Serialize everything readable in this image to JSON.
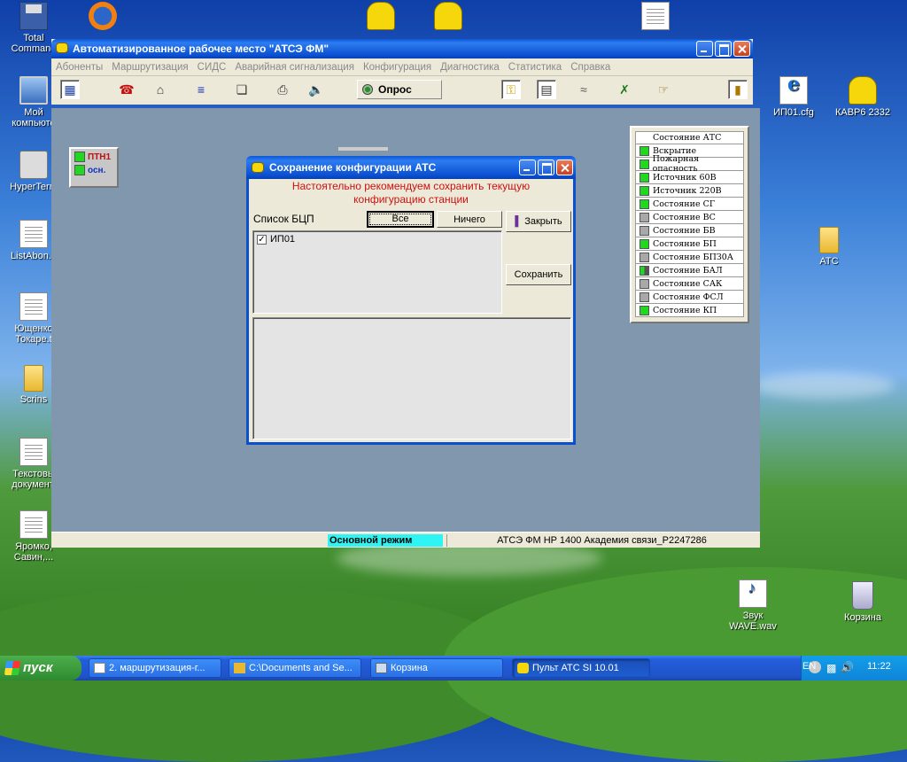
{
  "desktop": {
    "icons": [
      {
        "label": "Total Command"
      },
      {
        "label": "Мой компьюте"
      },
      {
        "label": "HyperTerm"
      },
      {
        "label": "ListAbon.n"
      },
      {
        "label": "Ющенко Токаре.t"
      },
      {
        "label": "Scrins"
      },
      {
        "label": "Текстовы документ."
      },
      {
        "label": "Яромко, Савин,..."
      },
      {
        "label": "ИП01.cfg"
      },
      {
        "label": "КАВР6 2332"
      },
      {
        "label": "АТС"
      },
      {
        "label": "Звук WAVE.wav"
      },
      {
        "label": "Корзина"
      }
    ]
  },
  "app": {
    "title": "Автоматизированное рабочее место \"АТСЭ ФМ\"",
    "menu": [
      "Абоненты",
      "Маршрутизация",
      "СИДС",
      "Аварийная сигнализация",
      "Конфигурация",
      "Диагностика",
      "Статистика",
      "Справка"
    ],
    "poll_label": "Опрос",
    "status": {
      "mode": "Основной режим",
      "info": "АТСЭ ФМ HP 1400 Академия связи_P2247286"
    }
  },
  "ptn": {
    "row1": "ПТН1",
    "row2": "осн."
  },
  "states": [
    {
      "label": "Состояние АТС",
      "led": "none"
    },
    {
      "label": "Вскрытие",
      "led": "green"
    },
    {
      "label": "Пожарная опасность",
      "led": "green"
    },
    {
      "label": "Источник 60В",
      "led": "green"
    },
    {
      "label": "Источник 220В",
      "led": "green"
    },
    {
      "label": "Состояние СГ",
      "led": "green"
    },
    {
      "label": "Состояние ВС",
      "led": "gray"
    },
    {
      "label": "Состояние БВ",
      "led": "gray"
    },
    {
      "label": "Состояние БП",
      "led": "green"
    },
    {
      "label": "Состояние БПЗ0А",
      "led": "gray"
    },
    {
      "label": "Состояние БАЛ",
      "led": "split"
    },
    {
      "label": "Состояние САК",
      "led": "gray"
    },
    {
      "label": "Состояние ФСЛ",
      "led": "gray"
    },
    {
      "label": "Состояние КП",
      "led": "green"
    }
  ],
  "dialog": {
    "title": "Сохранение конфигурации АТС",
    "warning_line1": "Настоятельно рекомендуем сохранить текущую",
    "warning_line2": "конфигурацию станции",
    "list_label": "Список БЦП",
    "btn_all": "Все",
    "btn_none": "Ничего",
    "btn_close": "Закрыть",
    "btn_save": "Сохранить",
    "items": [
      {
        "label": "ИП01",
        "checked": true
      }
    ]
  },
  "taskbar": {
    "start": "пуск",
    "tasks": [
      {
        "label": "2. маршрутизация-г..."
      },
      {
        "label": "C:\\Documents and Se..."
      },
      {
        "label": "Корзина"
      },
      {
        "label": "Пульт АТС  SI 10.01"
      }
    ],
    "lang": "EN",
    "clock": "11:22"
  }
}
